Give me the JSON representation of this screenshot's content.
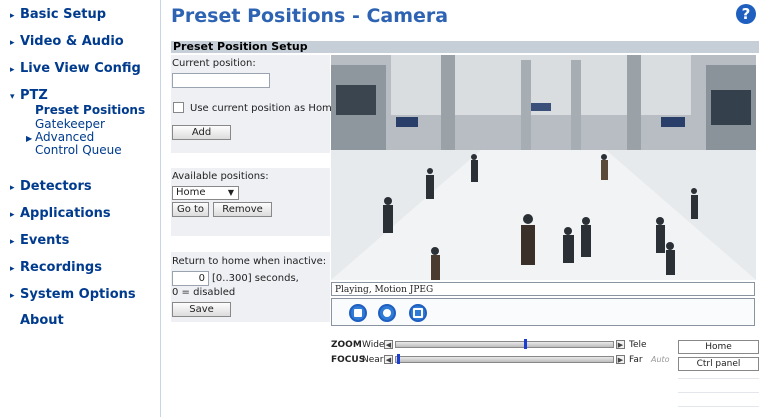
{
  "sidebar": {
    "items": [
      {
        "label": "Basic Setup"
      },
      {
        "label": "Video & Audio"
      },
      {
        "label": "Live View Config"
      },
      {
        "label": "PTZ"
      },
      {
        "label": "Detectors"
      },
      {
        "label": "Applications"
      },
      {
        "label": "Events"
      },
      {
        "label": "Recordings"
      },
      {
        "label": "System Options"
      },
      {
        "label": "About"
      }
    ],
    "ptz_sub": {
      "preset": "Preset Positions",
      "gatekeeper": "Gatekeeper",
      "advanced_1": "Advanced",
      "advanced_2": "Control Queue"
    }
  },
  "header": {
    "title": "Preset Positions - Camera",
    "help_icon": "?"
  },
  "section": {
    "title": "Preset Position Setup"
  },
  "form": {
    "current_position_label": "Current position:",
    "current_position_value": "",
    "use_home_label": "Use current position as Home",
    "use_home_checked": false,
    "add_label": "Add",
    "available_label": "Available positions:",
    "available_selected": "Home",
    "goto_label": "Go to",
    "remove_label": "Remove",
    "return_label": "Return to home when inactive:",
    "return_value": "0",
    "return_range": "[0..300] seconds,",
    "disabled_note": "0 = disabled",
    "save_label": "Save"
  },
  "video": {
    "status_text": "Playing, Motion JPEG",
    "controls": [
      "stop-icon",
      "snapshot-icon",
      "fullscreen-icon"
    ]
  },
  "ptz": {
    "zoom_label": "ZOOM",
    "zoom_min": "Wide",
    "zoom_max": "Tele",
    "zoom_level": 0.6,
    "focus_label": "FOCUS",
    "focus_min": "Near",
    "focus_max": "Far",
    "focus_auto": "Auto",
    "focus_level": 0.0,
    "home_button": "Home",
    "ctrl_panel_button": "Ctrl panel"
  },
  "colors": {
    "accent": "#2d63b2",
    "nav": "#003b8e",
    "thumb": "#1a3fd0"
  }
}
